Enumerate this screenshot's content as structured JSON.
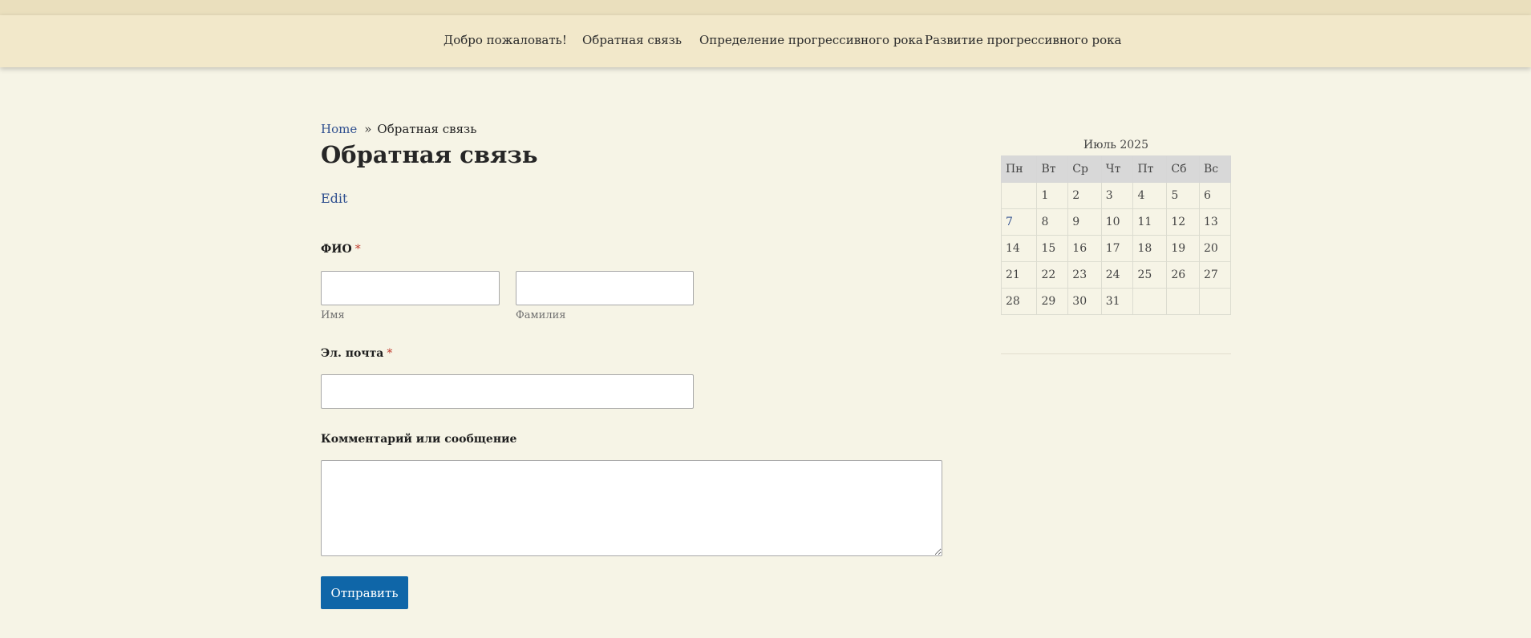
{
  "nav": {
    "items": [
      {
        "label": "Добро пожаловать!"
      },
      {
        "label": "Обратная связь"
      },
      {
        "label": "Определение прогрессивного рока"
      },
      {
        "label": "Развитие прогрессивного рока"
      }
    ]
  },
  "breadcrumb": {
    "home": "Home",
    "separator": "»",
    "current": "Обратная связь"
  },
  "page": {
    "title": "Обратная связь",
    "edit_label": "Edit"
  },
  "form": {
    "name": {
      "label": "ФИО",
      "required_mark": "*",
      "first_sublabel": "Имя",
      "last_sublabel": "Фамилия",
      "first_value": "",
      "last_value": ""
    },
    "email": {
      "label": "Эл. почта",
      "required_mark": "*",
      "value": ""
    },
    "comment": {
      "label": "Комментарий или сообщение",
      "value": ""
    },
    "submit_label": "Отправить"
  },
  "calendar": {
    "caption": "Июль 2025",
    "weekdays": [
      "Пн",
      "Вт",
      "Ср",
      "Чт",
      "Пт",
      "Сб",
      "Вс"
    ],
    "weeks": [
      [
        "",
        "1",
        "2",
        "3",
        "4",
        "5",
        "6"
      ],
      [
        "7",
        "8",
        "9",
        "10",
        "11",
        "12",
        "13"
      ],
      [
        "14",
        "15",
        "16",
        "17",
        "18",
        "19",
        "20"
      ],
      [
        "21",
        "22",
        "23",
        "24",
        "25",
        "26",
        "27"
      ],
      [
        "28",
        "29",
        "30",
        "31",
        "",
        "",
        ""
      ]
    ],
    "linked_day": "7"
  },
  "colors": {
    "accent": "#0f66a8",
    "link": "#2f4f8f",
    "required": "#c0392b",
    "navbar": "#f2e8ca",
    "background": "#f6f4e6"
  }
}
